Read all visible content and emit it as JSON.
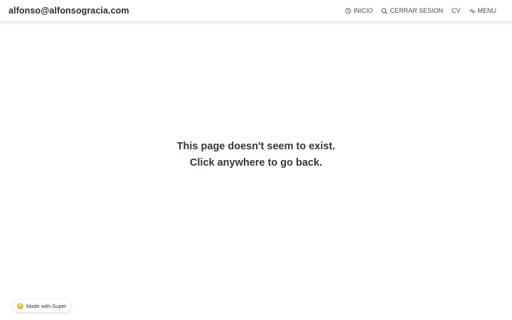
{
  "header": {
    "brand": "alfonso@alfonsogracia.com",
    "nav": [
      {
        "label": "INICIO",
        "icon": "clock-icon"
      },
      {
        "label": "CERRAR SESION",
        "icon": "search-icon"
      },
      {
        "label": "CV",
        "icon": ""
      },
      {
        "label": "MENU",
        "icon": "activity-icon"
      }
    ]
  },
  "main": {
    "message_line1": "This page doesn't seem to exist.",
    "message_line2": "Click anywhere to go back."
  },
  "badge": {
    "label": "Made with Super",
    "logo_letter": "S",
    "logo_color": "#f2b233"
  },
  "colors": {
    "text": "#37352f",
    "background": "#ffffff"
  }
}
